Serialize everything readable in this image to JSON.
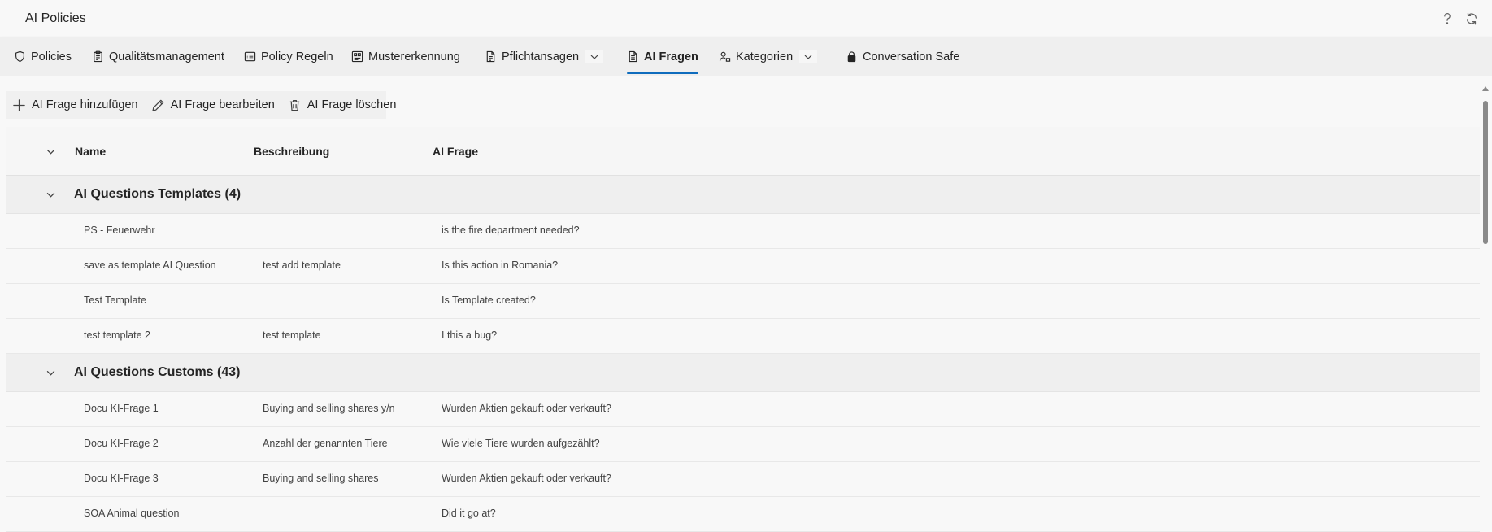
{
  "app": {
    "title": "AI Policies",
    "help_icon": "help-icon",
    "refresh_icon": "refresh-icon"
  },
  "nav": {
    "tabs": [
      {
        "label": "Policies",
        "icon": "shield-icon"
      },
      {
        "label": "Qualitätsmanagement",
        "icon": "clipboard-icon"
      },
      {
        "label": "Policy Regeln",
        "icon": "rules-list-icon"
      },
      {
        "label": "Mustererkennung",
        "icon": "pattern-icon"
      },
      {
        "label": "Pflichtansagen",
        "icon": "document-icon",
        "has_dropdown": true
      },
      {
        "label": "AI Fragen",
        "icon": "document-text-icon",
        "active": true
      },
      {
        "label": "Kategorien",
        "icon": "people-tag-icon",
        "has_dropdown": true
      },
      {
        "label": "Conversation Safe",
        "icon": "lock-icon"
      }
    ],
    "active_color": "#0f6cbd"
  },
  "commandbar": {
    "add_label": "AI Frage hinzufügen",
    "edit_label": "AI Frage bearbeiten",
    "delete_label": "AI Frage löschen"
  },
  "grid": {
    "columns": [
      "Name",
      "Beschreibung",
      "AI Frage"
    ],
    "groups": [
      {
        "title": "AI Questions Templates (4)",
        "rows": [
          {
            "name": "PS - Feuerwehr",
            "description": "",
            "question": "is the fire department needed?"
          },
          {
            "name": "save as template AI Question",
            "description": "test add template",
            "question": "Is this action in Romania?"
          },
          {
            "name": "Test Template",
            "description": "",
            "question": "Is Template created?"
          },
          {
            "name": "test template 2",
            "description": "test template",
            "question": "I this a bug?"
          }
        ]
      },
      {
        "title": "AI Questions Customs (43)",
        "rows": [
          {
            "name": "Docu KI-Frage 1",
            "description": "Buying and selling shares y/n",
            "question": "Wurden Aktien gekauft oder verkauft?"
          },
          {
            "name": "Docu KI-Frage 2",
            "description": "Anzahl der genannten Tiere",
            "question": "Wie viele Tiere wurden aufgezählt?"
          },
          {
            "name": "Docu KI-Frage 3",
            "description": "Buying and selling shares",
            "question": "Wurden Aktien gekauft oder verkauft?"
          },
          {
            "name": "SOA Animal question",
            "description": "",
            "question": "Did it go at?"
          }
        ]
      }
    ]
  }
}
